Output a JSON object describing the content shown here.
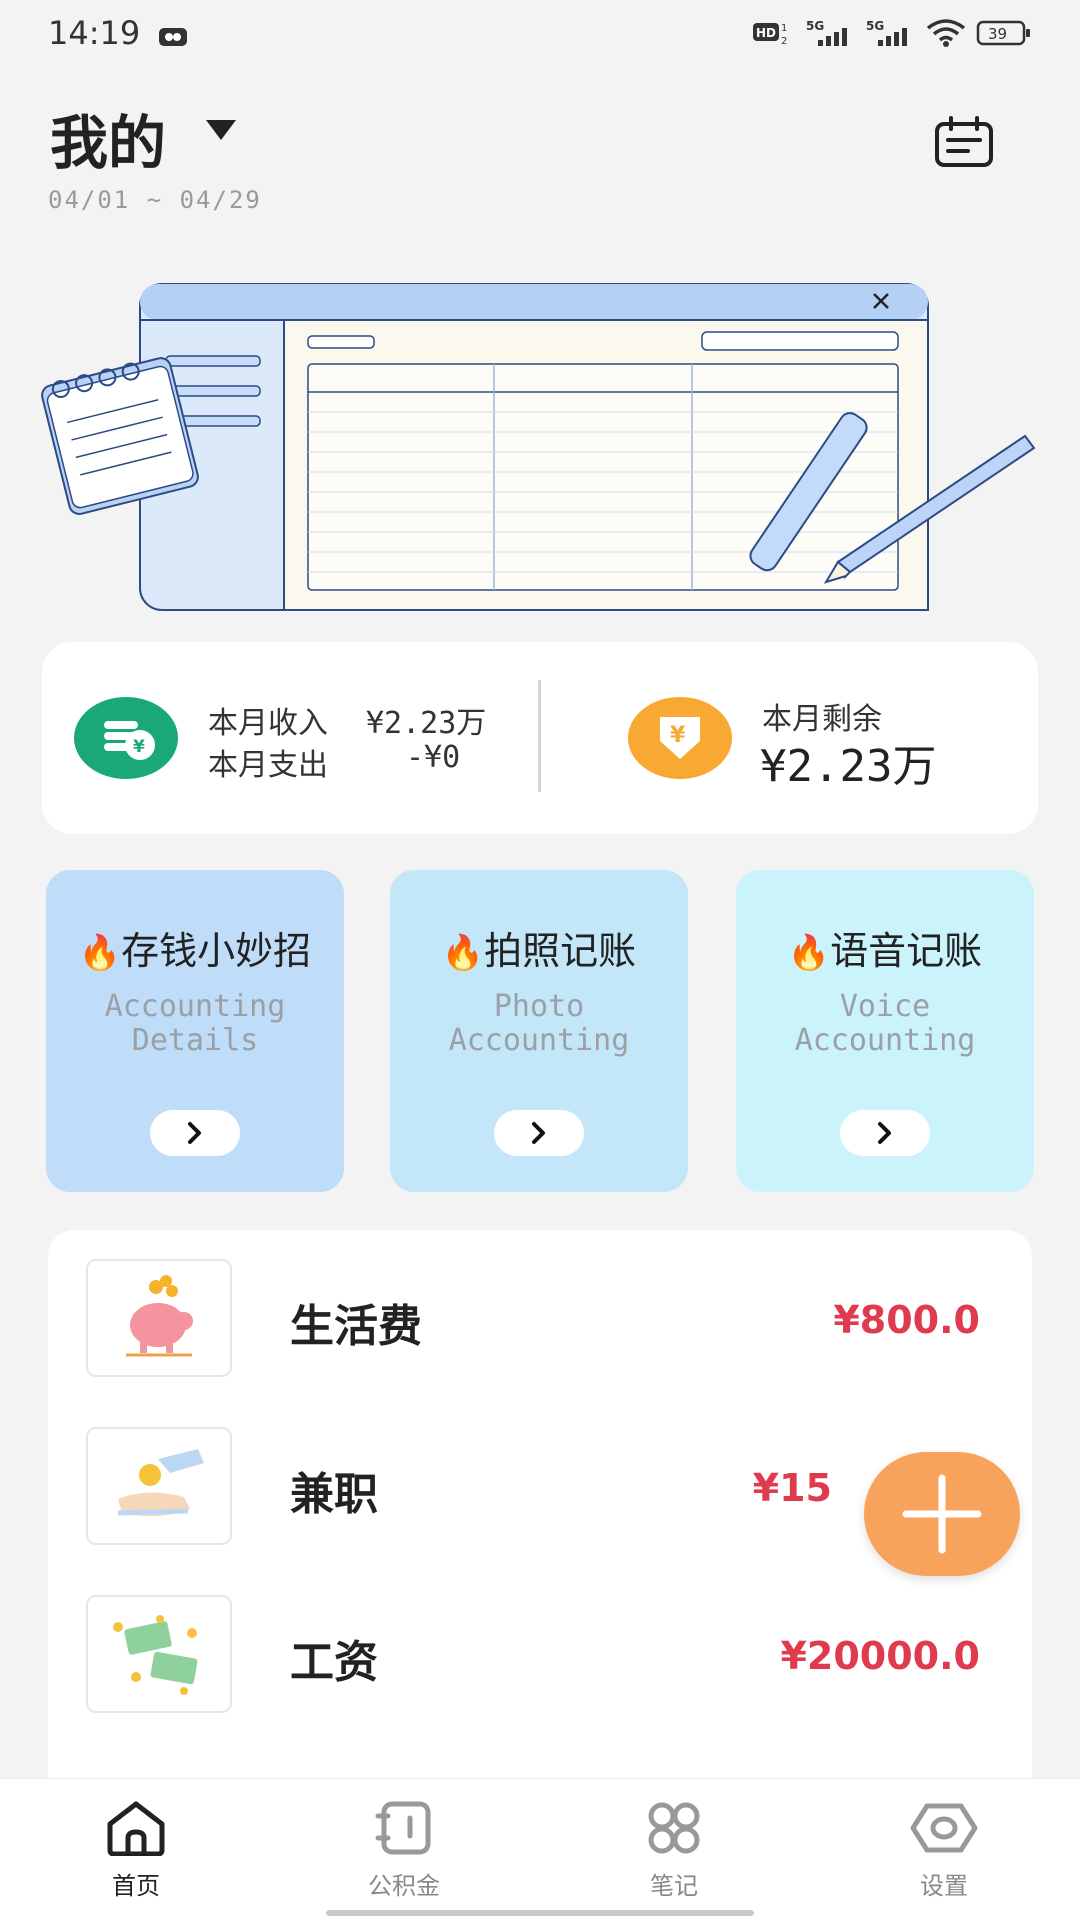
{
  "status_bar": {
    "time": "14:19",
    "battery": "39",
    "icons": [
      "hd-icon",
      "signal-5g-icon",
      "signal-5g-icon",
      "wifi-icon",
      "battery-icon"
    ]
  },
  "header": {
    "title": "我的",
    "date_range": "04/01 ~ 04/29",
    "calendar_icon": "calendar-icon"
  },
  "summary": {
    "income_label": "本月收入",
    "income_value": "¥2.23万",
    "expense_label": "本月支出",
    "expense_value": "-¥0",
    "remain_label": "本月剩余",
    "remain_value": "¥2.23万"
  },
  "features": [
    {
      "title": "存钱小妙招",
      "subtitle": "Accounting\nDetails",
      "color": "#bfdcf8"
    },
    {
      "title": "拍照记账",
      "subtitle": "Photo\nAccounting",
      "color": "#c3e6f8"
    },
    {
      "title": "语音记账",
      "subtitle": "Voice\nAccounting",
      "color": "#cbf3fb"
    }
  ],
  "records": [
    {
      "name": "生活费",
      "amount": "¥800.0",
      "icon": "piggy-bank-icon"
    },
    {
      "name": "兼职",
      "amount": "¥15",
      "icon": "coin-hand-icon"
    },
    {
      "name": "工资",
      "amount": "¥20000.0",
      "icon": "cash-icon"
    }
  ],
  "tabs": [
    {
      "label": "首页",
      "icon": "home-icon",
      "active": true
    },
    {
      "label": "公积金",
      "icon": "notebook-icon",
      "active": false
    },
    {
      "label": "笔记",
      "icon": "grid-icon",
      "active": false
    },
    {
      "label": "设置",
      "icon": "settings-icon",
      "active": false
    }
  ],
  "colors": {
    "accent_amount": "#e03a4e",
    "fab": "#f7a35b"
  }
}
